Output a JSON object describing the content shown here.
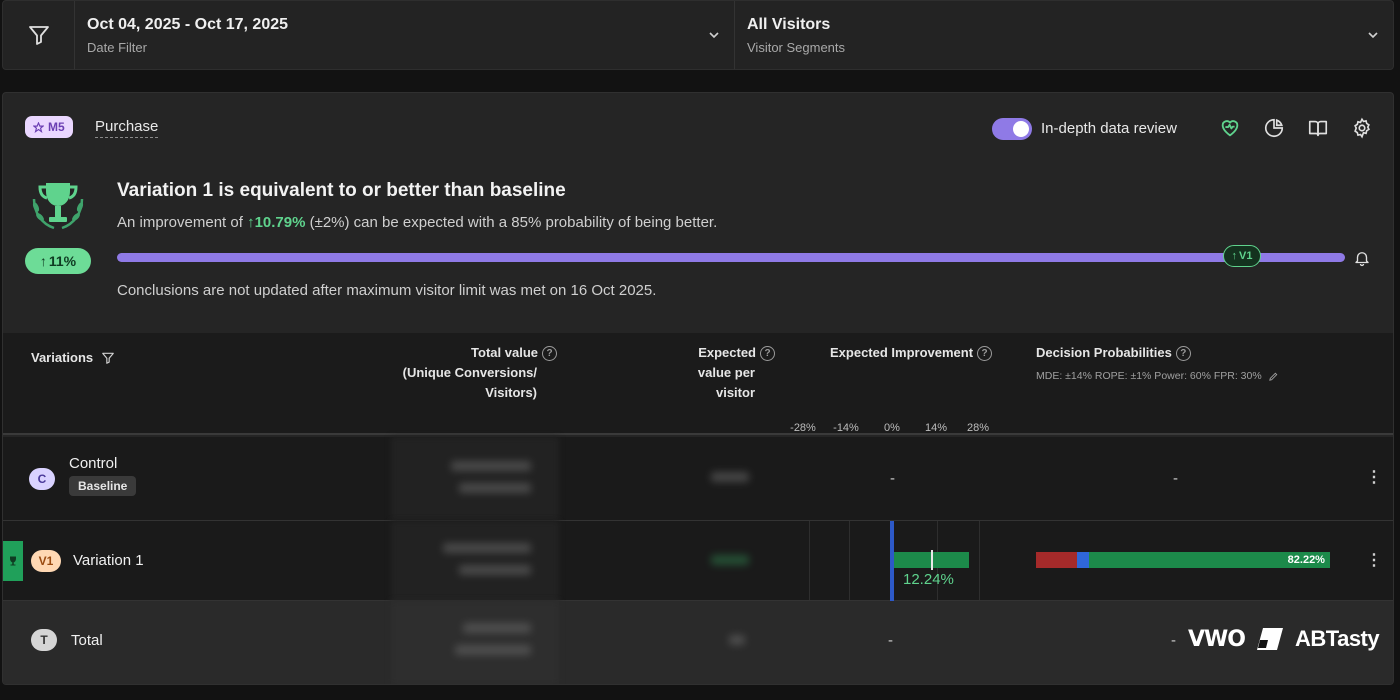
{
  "filters": {
    "date_value": "Oct 04, 2025 - Oct 17, 2025",
    "date_label": "Date Filter",
    "segment_value": "All Visitors",
    "segment_label": "Visitor Segments"
  },
  "goal": {
    "badge": "M5",
    "name": "Purchase"
  },
  "header": {
    "toggle_label": "In-depth data review",
    "toggle_on": true
  },
  "verdict": {
    "title": "Variation 1 is equivalent to or better than baseline",
    "sub_prefix": "An improvement of",
    "improvement": "10.79%",
    "sub_suffix": "(±2%) can be expected with a 85% probability of being better.",
    "badge": "11%",
    "marker": "V1",
    "progress_fraction": 1.0,
    "note": "Conclusions are not updated after maximum visitor limit was met on 16 Oct 2025."
  },
  "table": {
    "columns": {
      "variations": "Variations",
      "total_value_1": "Total value",
      "total_value_2": "(Unique Conversions/",
      "total_value_3": "Visitors)",
      "evpv_1": "Expected",
      "evpv_2": "value per",
      "evpv_3": "visitor",
      "expected_improvement": "Expected Improvement",
      "decision_probabilities": "Decision Probabilities",
      "decision_sub": "MDE: ±14% ROPE: ±1% Power: 60% FPR: 30%"
    },
    "ticks": [
      "-28%",
      "-14%",
      "0%",
      "14%",
      "28%"
    ],
    "rows": {
      "control": {
        "chip": "C",
        "name": "Control",
        "tag": "Baseline",
        "improvement": "-",
        "decision": "-"
      },
      "variation1": {
        "chip": "V1",
        "name": "Variation 1",
        "improvement": "12.24%",
        "decision_pct": "82.22%",
        "decision_fractions": {
          "worse": 0.14,
          "equal": 0.04,
          "better": 0.8222
        }
      },
      "total": {
        "chip": "T",
        "name": "Total",
        "improvement": "-",
        "decision": "-"
      }
    }
  },
  "branding": {
    "vwo": "VWO",
    "abtasty": "ABTasty"
  },
  "colors": {
    "accent": "#8f7ae6",
    "positive": "#5fd38d",
    "negative": "#a52a2a",
    "neutral": "#2f67d9"
  }
}
